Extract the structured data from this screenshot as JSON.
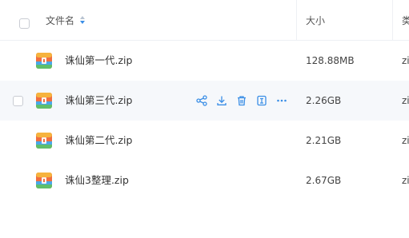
{
  "header": {
    "name_label": "文件名",
    "size_label": "大小",
    "type_label": "类"
  },
  "files": [
    {
      "name": "诛仙第一代.zip",
      "size": "128.88MB",
      "type": "zi"
    },
    {
      "name": "诛仙第三代.zip",
      "size": "2.26GB",
      "type": "zi"
    },
    {
      "name": "诛仙第二代.zip",
      "size": "2.21GB",
      "type": "zi"
    },
    {
      "name": "诛仙3整理.zip",
      "size": "2.67GB",
      "type": "zi"
    }
  ],
  "row_actions": [
    "share-icon",
    "download-icon",
    "delete-icon",
    "move-icon",
    "more-icon"
  ],
  "colors": {
    "accent": "#3a8ee6",
    "hover_row": "#f6f8fb",
    "border": "#eef0f4"
  }
}
